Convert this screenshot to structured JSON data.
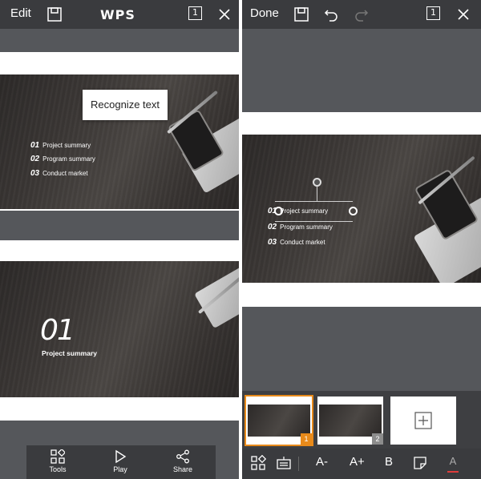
{
  "left_pane": {
    "topbar": {
      "edit_label": "Edit",
      "logo_text": "WPS",
      "page_indicator": "1"
    },
    "slide1": {
      "popup_text": "Recognize text",
      "items": [
        {
          "num": "01",
          "label": "Project summary"
        },
        {
          "num": "02",
          "label": "Program summary"
        },
        {
          "num": "03",
          "label": "Conduct market"
        }
      ]
    },
    "slide2": {
      "big_number": "01",
      "title": "Project summary"
    },
    "bottom_bar": {
      "tools_label": "Tools",
      "play_label": "Play",
      "share_label": "Share"
    }
  },
  "right_pane": {
    "topbar": {
      "done_label": "Done",
      "page_indicator": "1"
    },
    "slide": {
      "items": [
        {
          "num": "01",
          "label": "Project summary"
        },
        {
          "num": "02",
          "label": "Program summary"
        },
        {
          "num": "03",
          "label": "Conduct market"
        }
      ]
    },
    "thumbnails": [
      {
        "badge": "1",
        "active": true,
        "badge_color": "#e88a1a"
      },
      {
        "badge": "2",
        "active": false,
        "badge_color": "#8c8c8c"
      }
    ],
    "toolbar": {
      "font_smaller": "A-",
      "font_larger": "A+",
      "bold": "B",
      "font_color": "A"
    }
  },
  "colors": {
    "accent": "#e88a1a",
    "bar_bg": "#3a3b3e",
    "pane_bg": "#55575b"
  }
}
